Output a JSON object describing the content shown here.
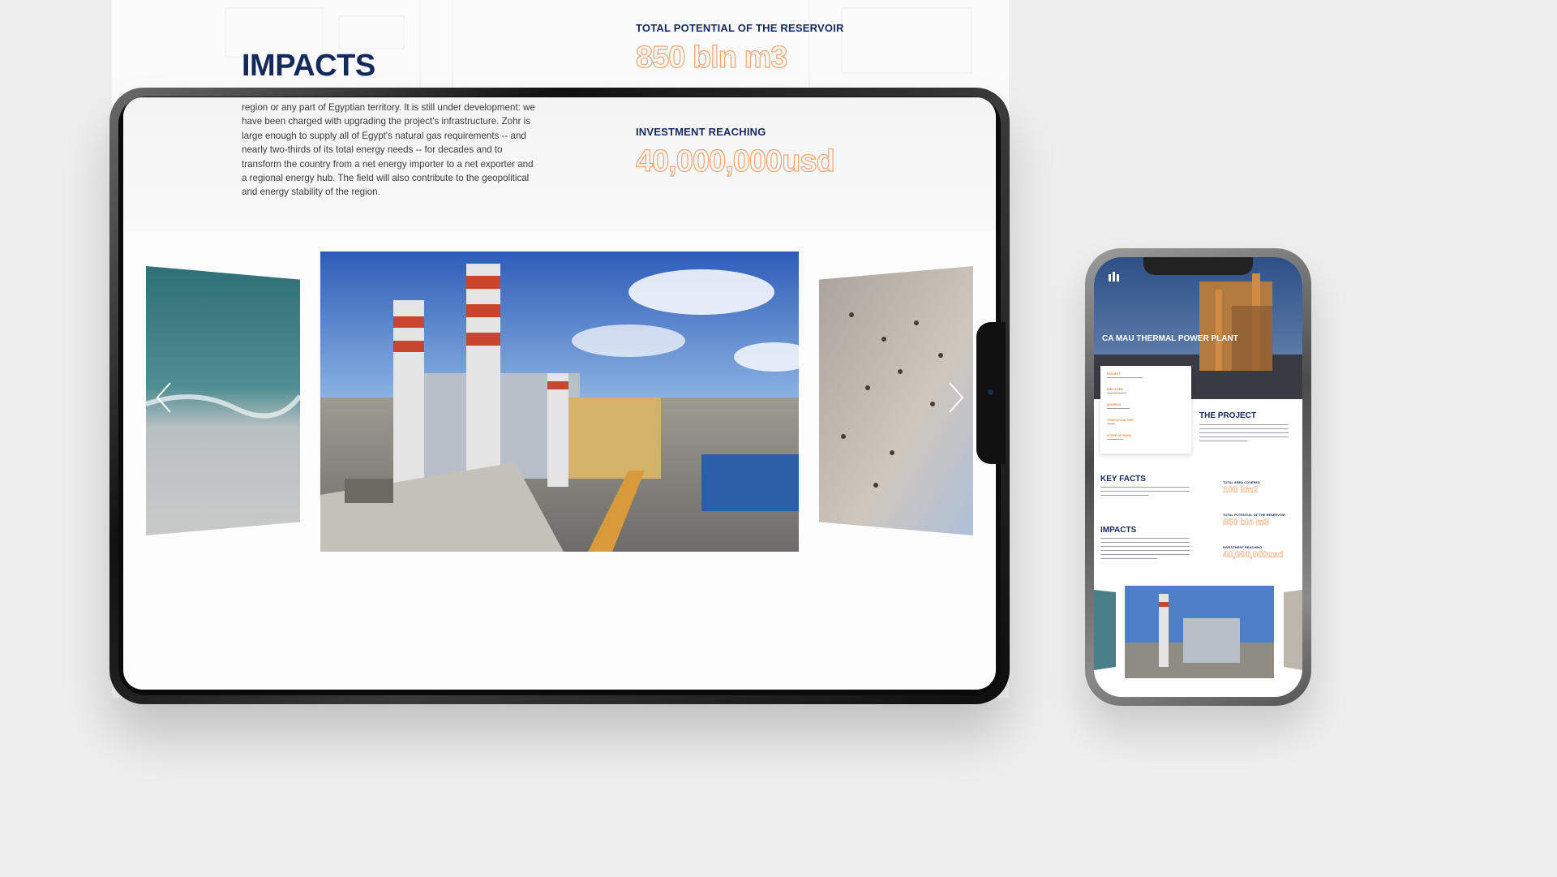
{
  "desktop": {
    "heading": "IMPACTS",
    "paragraph_lines": [
      "region or any part of Egyptian territory. It is still under development: we",
      "have been charged with upgrading the project's infrastructure. Zohr is",
      "large enough to supply all of Egypt's natural gas requirements -- and",
      "nearly two-thirds of its total energy needs -- for decades and to",
      "transform the country from a net energy importer to a net exporter and",
      "a regional energy hub. The field will also contribute to the geopolitical",
      "and energy stability of the region."
    ],
    "stats": [
      {
        "label": "TOTAL POTENTIAL OF THE RESERVOIR",
        "value": "850 bln m3"
      },
      {
        "label": "INVESTMENT REACHING",
        "value": "40,000,000usd"
      }
    ],
    "carousel": {
      "prev_icon": "chevron-left-icon",
      "next_icon": "chevron-right-icon"
    }
  },
  "mobile": {
    "hero_title": "CA MAU THERMAL POWER PLANT",
    "project_title": "THE PROJECT",
    "key_facts_title": "KEY FACTS",
    "impacts_title": "IMPACTS",
    "info_labels": [
      "PROJECT",
      "EMPLOYER",
      "ADDRESS",
      "COMPLETION TIME",
      "SCOPE OF WORK"
    ],
    "stats": [
      {
        "label": "TOTAL AREA COVERED",
        "value": "100 km2"
      },
      {
        "label": "TOTAL POTENTIAL OF THE RESERVOIR",
        "value": "850 bln m3"
      },
      {
        "label": "INVESTMENT REACHING",
        "value": "40,000,000usd"
      }
    ]
  },
  "colors": {
    "navy": "#152a5c",
    "orange": "#f2a571"
  }
}
